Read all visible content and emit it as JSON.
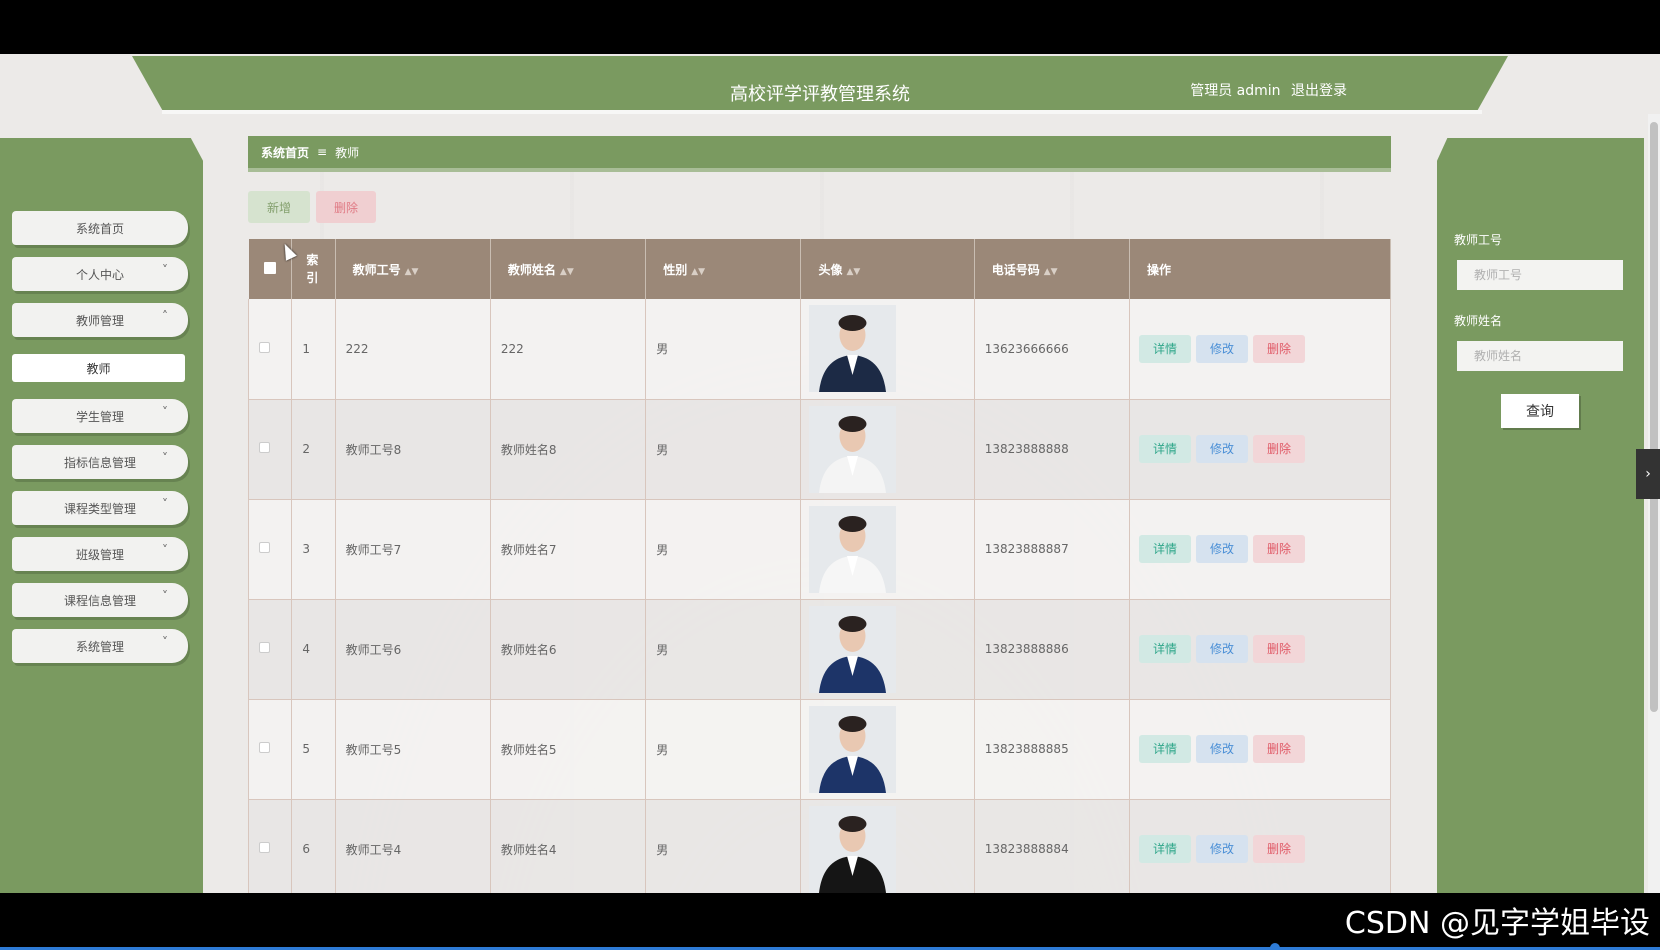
{
  "header": {
    "title": "高校评学评教管理系统",
    "user_label": "管理员 admin",
    "logout_label": "退出登录"
  },
  "sidebar": {
    "items": [
      {
        "label": "系统首页",
        "expandable": false
      },
      {
        "label": "个人中心",
        "expandable": true,
        "expanded": false
      },
      {
        "label": "教师管理",
        "expandable": true,
        "expanded": true
      },
      {
        "label": "教师",
        "sub": true
      },
      {
        "label": "学生管理",
        "expandable": true,
        "expanded": false
      },
      {
        "label": "指标信息管理",
        "expandable": true,
        "expanded": false
      },
      {
        "label": "课程类型管理",
        "expandable": true,
        "expanded": false
      },
      {
        "label": "班级管理",
        "expandable": true,
        "expanded": false
      },
      {
        "label": "课程信息管理",
        "expandable": true,
        "expanded": false
      },
      {
        "label": "系统管理",
        "expandable": true,
        "expanded": false
      }
    ],
    "chevron_down": "˅",
    "chevron_up": "˄"
  },
  "breadcrumb": {
    "home": "系统首页",
    "separator": "≡",
    "current": "教师"
  },
  "toolbar": {
    "add_label": "新增",
    "delete_label": "删除"
  },
  "table": {
    "columns": {
      "index": "索\n引",
      "teacher_no": "教师工号",
      "teacher_name": "教师姓名",
      "gender": "性别",
      "avatar": "头像",
      "phone": "电话号码",
      "actions": "操作"
    },
    "rows": [
      {
        "index": "1",
        "teacher_no": "222",
        "teacher_name": "222",
        "gender": "男",
        "phone": "13623666666"
      },
      {
        "index": "2",
        "teacher_no": "教师工号8",
        "teacher_name": "教师姓名8",
        "gender": "男",
        "phone": "13823888888"
      },
      {
        "index": "3",
        "teacher_no": "教师工号7",
        "teacher_name": "教师姓名7",
        "gender": "男",
        "phone": "13823888887"
      },
      {
        "index": "4",
        "teacher_no": "教师工号6",
        "teacher_name": "教师姓名6",
        "gender": "男",
        "phone": "13823888886"
      },
      {
        "index": "5",
        "teacher_no": "教师工号5",
        "teacher_name": "教师姓名5",
        "gender": "男",
        "phone": "13823888885"
      },
      {
        "index": "6",
        "teacher_no": "教师工号4",
        "teacher_name": "教师姓名4",
        "gender": "男",
        "phone": "13823888884"
      }
    ],
    "action_labels": {
      "detail": "详情",
      "edit": "修改",
      "delete": "删除"
    }
  },
  "search": {
    "teacher_no_label": "教师工号",
    "teacher_no_placeholder": "教师工号",
    "teacher_name_label": "教师姓名",
    "teacher_name_placeholder": "教师姓名",
    "submit_label": "查询"
  },
  "watermark": "CSDN @见字学姐毕设",
  "colors": {
    "primary_green": "#7a9a60",
    "table_header": "#9b8878",
    "detail": "#2fa68a",
    "edit": "#4a8fd6",
    "delete": "#e05a67"
  }
}
